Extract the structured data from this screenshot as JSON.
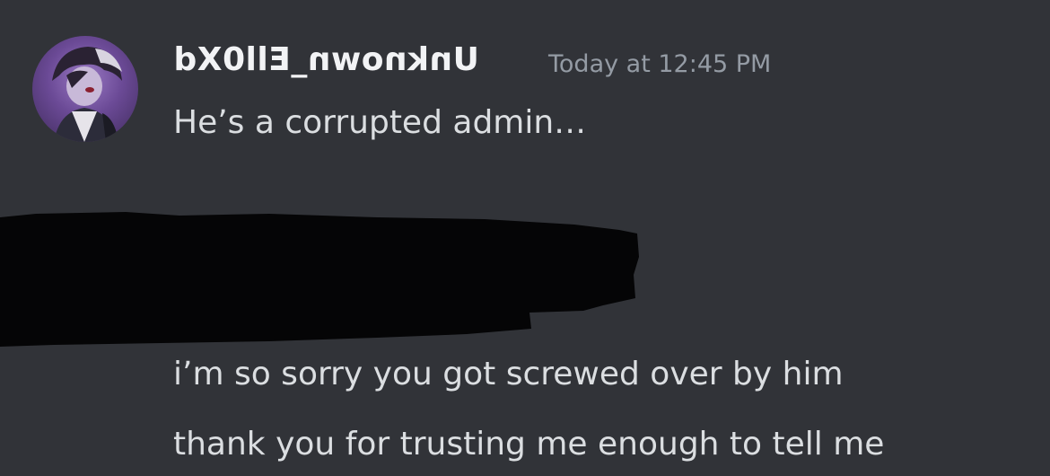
{
  "message": {
    "author": "Unknown_Ell0Xd",
    "timestamp": "Today at 12:45 PM",
    "lines": [
      "He’s a corrupted admin…",
      "i’m so sorry you got screwed over by him",
      "thank you for trusting me enough to tell me"
    ]
  },
  "colors": {
    "background": "#313338",
    "username": "#f2f3f5",
    "timestamp": "#949ba4",
    "text": "#dbdee1",
    "redaction": "#050506"
  }
}
